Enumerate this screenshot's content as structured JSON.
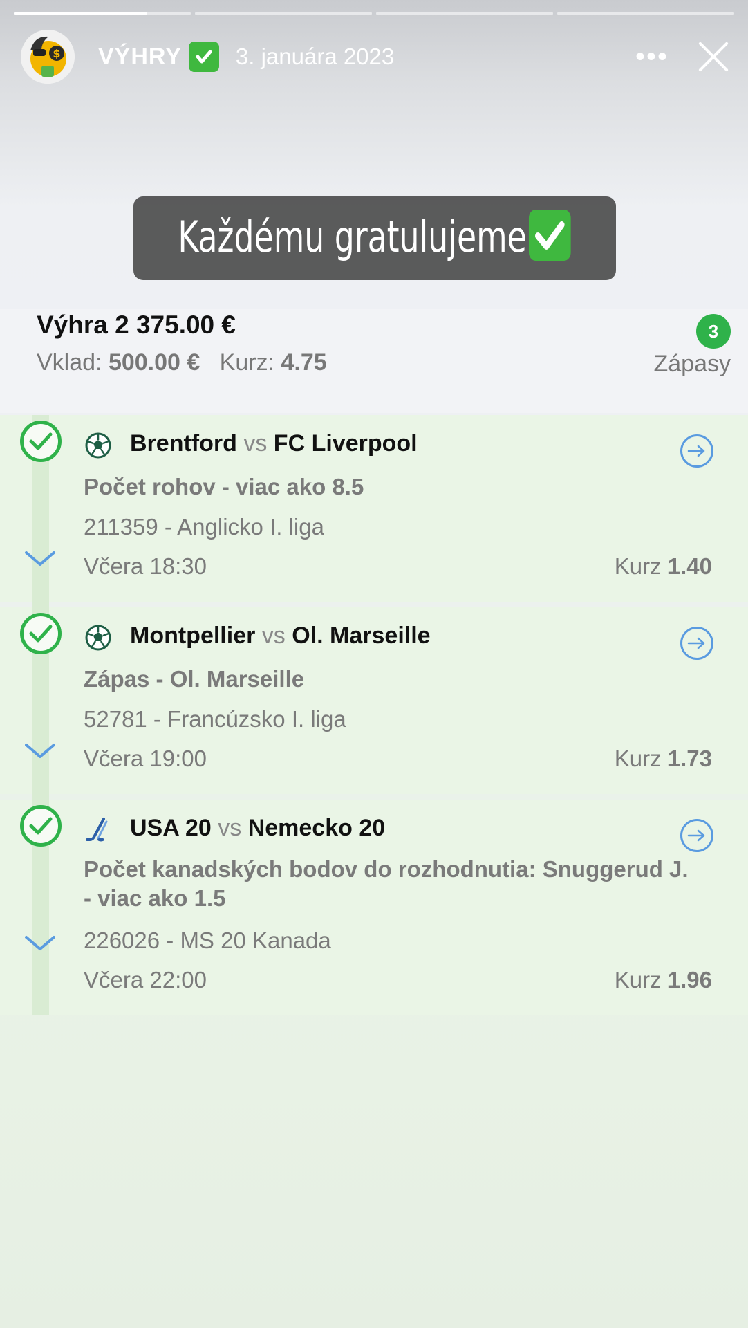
{
  "story": {
    "progress": [
      1.0,
      0.0,
      0.0,
      0.0
    ],
    "progress_current_fill": 0.75,
    "title": "VÝHRY",
    "date": "3. januára 2023",
    "more_label": "•••"
  },
  "caption": {
    "text": "Každému gratulujeme"
  },
  "summary": {
    "win": "Výhra 2 375.00 €",
    "stake_label": "Vklad:",
    "stake_value": "500.00 €",
    "odds_label": "Kurz:",
    "odds_value": "4.75",
    "count": "3",
    "matches_label": "Zápasy"
  },
  "bets": [
    {
      "sport_icon": "soccer-ball-icon",
      "home": "Brentford",
      "vs": "vs",
      "away": "FC Liverpool",
      "market": "Počet rohov - viac ako 8.5",
      "league": "211359 - Anglicko I. liga",
      "time": "Včera 18:30",
      "odds_label": "Kurz",
      "odds": "1.40"
    },
    {
      "sport_icon": "soccer-ball-icon",
      "home": "Montpellier",
      "vs": "vs",
      "away": "Ol. Marseille",
      "market": "Zápas - Ol. Marseille",
      "league": "52781 - Francúzsko I. liga",
      "time": "Včera 19:00",
      "odds_label": "Kurz",
      "odds": "1.73"
    },
    {
      "sport_icon": "hockey-stick-icon",
      "home": "USA 20",
      "vs": "vs",
      "away": "Nemecko 20",
      "market_line1": "Počet kanadských bodov do rozhodnutia: Snuggerud J.",
      "market_line2": "- viac ako 1.5",
      "league": "226026 - MS 20 Kanada",
      "time": "Včera 22:00",
      "odds_label": "Kurz",
      "odds": "1.96"
    }
  ],
  "colors": {
    "win_green": "#2fb24a",
    "link_blue": "#5a9be0",
    "bet_bg": "#eaf5e6"
  }
}
